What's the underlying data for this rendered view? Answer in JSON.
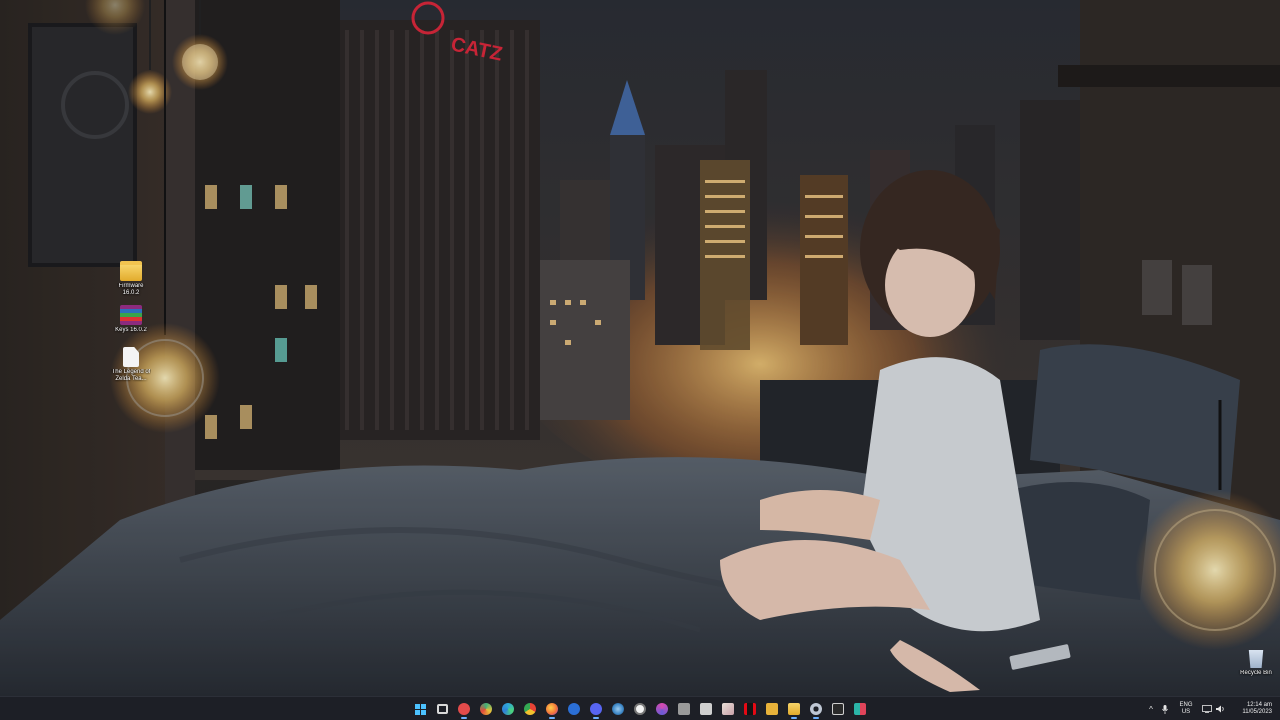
{
  "desktop": {
    "icons": [
      {
        "label": "Firmware 16.0.2",
        "icon": "folder-icon"
      },
      {
        "label": "Keys 16.0.2",
        "icon": "winrar-archive-icon"
      },
      {
        "label": "The Legend of Zelda Tea...",
        "icon": "file-icon"
      },
      {
        "label": "Recycle Bin",
        "icon": "recycle-bin-icon"
      }
    ],
    "wallpaper": {
      "sign_text": "CATZ"
    }
  },
  "taskbar": {
    "pinned": [
      {
        "name": "start-button",
        "icon": "windows-logo-icon",
        "color": "#4cc2ff"
      },
      {
        "name": "task-view-button",
        "icon": "task-view-icon",
        "color": "#d9d9d9"
      },
      {
        "name": "taskbar-app-1",
        "icon": "app-red-circle-icon",
        "color": "#e34b4b"
      },
      {
        "name": "taskbar-app-2",
        "icon": "app-multicolor-icon",
        "color": "#3fb07a"
      },
      {
        "name": "taskbar-edge",
        "icon": "edge-icon",
        "color": "#2fa7d8"
      },
      {
        "name": "taskbar-chrome",
        "icon": "chrome-icon",
        "color": "#f2c12e"
      },
      {
        "name": "taskbar-firefox",
        "icon": "firefox-icon",
        "color": "#f2753a"
      },
      {
        "name": "taskbar-app-3",
        "icon": "app-blue-icon",
        "color": "#2b6fd6"
      },
      {
        "name": "taskbar-discord",
        "icon": "discord-icon",
        "color": "#5865f2"
      },
      {
        "name": "taskbar-steam",
        "icon": "steam-icon",
        "color": "#3b86c6"
      },
      {
        "name": "taskbar-app-4",
        "icon": "app-white-icon",
        "color": "#dcdcdc"
      },
      {
        "name": "taskbar-app-5",
        "icon": "app-pink-icon",
        "color": "#d64ab0"
      },
      {
        "name": "taskbar-app-6",
        "icon": "app-gray-icon",
        "color": "#9a9a9a"
      },
      {
        "name": "taskbar-app-7",
        "icon": "app-document-icon",
        "color": "#cfcfcf"
      },
      {
        "name": "taskbar-app-8",
        "icon": "app-photo-icon",
        "color": "#e8e0d8"
      },
      {
        "name": "taskbar-netflix",
        "icon": "netflix-icon",
        "color": "#e50914"
      },
      {
        "name": "taskbar-app-9",
        "icon": "app-yellow-icon",
        "color": "#e8b23a"
      },
      {
        "name": "taskbar-file-explorer",
        "icon": "folder-icon",
        "color": "#f4c442"
      },
      {
        "name": "taskbar-settings",
        "icon": "gear-icon",
        "color": "#bfc7d4"
      },
      {
        "name": "taskbar-terminal",
        "icon": "terminal-icon",
        "color": "#cfcfcf"
      },
      {
        "name": "taskbar-app-10",
        "icon": "app-teal-red-icon",
        "color": "#2bb5a8"
      }
    ],
    "tray": {
      "chevron": "^",
      "language": "ENG",
      "region": "US",
      "time": "12:14 am",
      "date": "11/05/2023"
    }
  }
}
